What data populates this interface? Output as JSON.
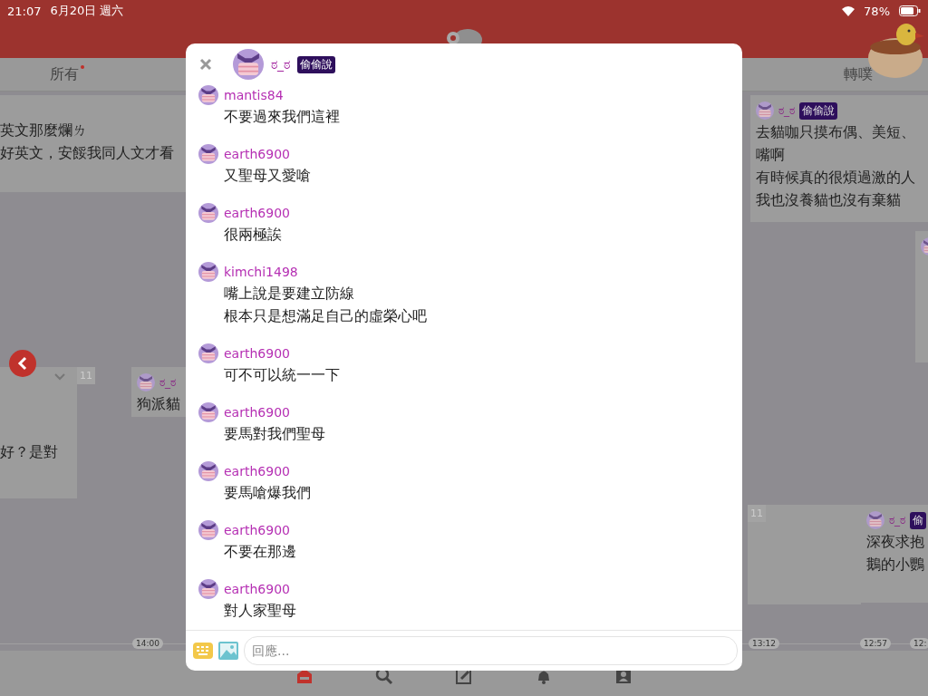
{
  "status_bar": {
    "time": "21:07",
    "date": "6月20日 週六",
    "battery": "78%"
  },
  "tabs": [
    {
      "label": "所有",
      "unread": true
    },
    {
      "label": "轉噗",
      "unread": false
    }
  ],
  "timeline": {
    "cards": [
      {
        "lines": [
          "英文那麼爛ㄌ",
          "好英文，安餒我同人文才看"
        ]
      },
      {
        "count": "11",
        "lines": [
          "好？是對"
        ]
      },
      {
        "name": "ಠ_ಠ",
        "lines": [
          "狗派貓"
        ]
      },
      {
        "name": "ಠ_ಠ",
        "badge": "偷偷說",
        "lines": [
          "去貓咖只摸布偶、美短、",
          "嘴啊",
          "有時候真的很煩過激的人",
          "我也沒養貓也沒有棄貓"
        ]
      },
      {
        "avatar": true
      },
      {
        "count": "11"
      },
      {
        "name": "ಠ_ಠ",
        "badge": "偷",
        "lines": [
          "深夜求抱",
          "鵝的小鸚"
        ]
      }
    ],
    "time_labels": [
      "14:00",
      "13:12",
      "12:57",
      "12:"
    ]
  },
  "nav": [
    {
      "kind": "home",
      "selected": true
    },
    {
      "kind": "search",
      "selected": false
    },
    {
      "kind": "edit",
      "selected": false
    },
    {
      "kind": "bell",
      "selected": false
    },
    {
      "kind": "profile",
      "selected": false
    }
  ],
  "dialog": {
    "name": "ಠ_ಠ",
    "badge": "偷偷說",
    "responses": [
      {
        "user": "mantis84",
        "lines": [
          "不要過來我們這裡"
        ]
      },
      {
        "user": "earth6900",
        "lines": [
          "又聖母又愛嗆"
        ]
      },
      {
        "user": "earth6900",
        "lines": [
          "很兩極誒"
        ]
      },
      {
        "user": "kimchi1498",
        "lines": [
          "嘴上說是要建立防線",
          "根本只是想滿足自己的虛榮心吧"
        ]
      },
      {
        "user": "earth6900",
        "lines": [
          "可不可以統一一下"
        ]
      },
      {
        "user": "earth6900",
        "lines": [
          "要馬對我們聖母"
        ]
      },
      {
        "user": "earth6900",
        "lines": [
          "要馬嗆爆我們"
        ]
      },
      {
        "user": "earth6900",
        "lines": [
          "不要在那邊"
        ]
      },
      {
        "user": "earth6900",
        "lines": [
          "對人家聖母"
        ]
      }
    ],
    "reply": {
      "placeholder": "回應..."
    }
  }
}
